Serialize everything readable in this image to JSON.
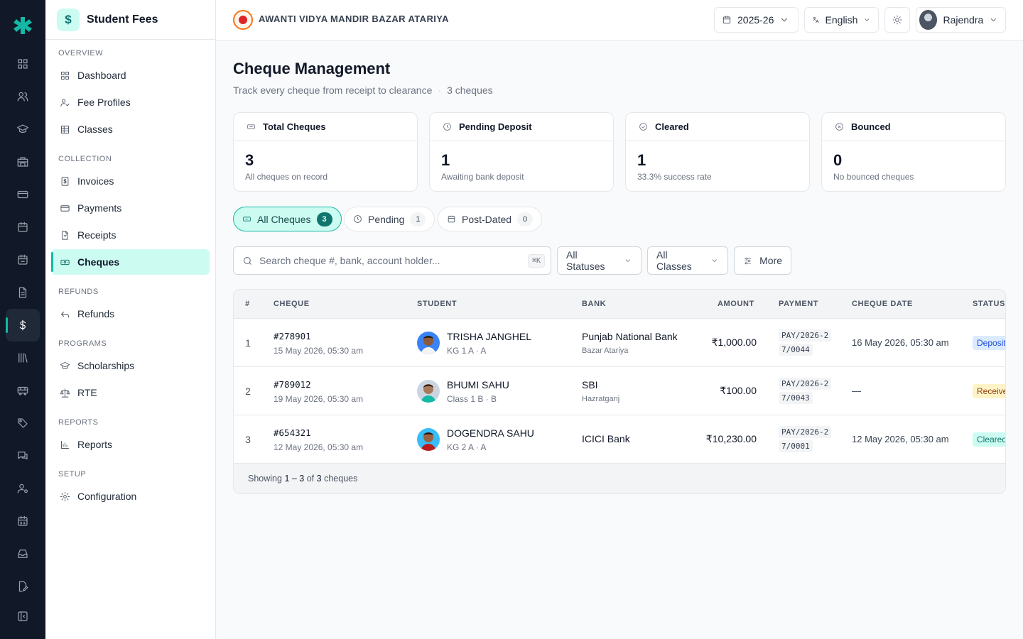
{
  "rail": {
    "icons": [
      "grid-icon",
      "users-icon",
      "graduation-cap-icon",
      "building-icon",
      "card-icon",
      "calendar-icon",
      "calendar-check-icon",
      "document-icon",
      "dollar-icon",
      "library-icon",
      "bus-icon",
      "tag-icon",
      "chat-icon",
      "user-cog-icon",
      "calendar-grid-icon",
      "inbox-icon",
      "file-edit-icon",
      "collapse-icon"
    ],
    "active": "dollar-icon"
  },
  "sidebar": {
    "badge": "$",
    "title": "Student Fees",
    "sections": {
      "overview": "OVERVIEW",
      "collection": "COLLECTION",
      "refunds": "REFUNDS",
      "programs": "PROGRAMS",
      "reports": "REPORTS",
      "setup": "SETUP"
    },
    "items": {
      "dashboard": "Dashboard",
      "fee_profiles": "Fee Profiles",
      "classes": "Classes",
      "invoices": "Invoices",
      "payments": "Payments",
      "receipts": "Receipts",
      "cheques": "Cheques",
      "refunds": "Refunds",
      "scholarships": "Scholarships",
      "rte": "RTE",
      "reports": "Reports",
      "configuration": "Configuration"
    },
    "active_item": "cheques"
  },
  "topbar": {
    "school_name": "AWANTI VIDYA MANDIR BAZAR ATARIYA",
    "session": "2025-26",
    "language": "English",
    "user": "Rajendra"
  },
  "page": {
    "title": "Cheque Management",
    "subtitle": "Track every cheque from receipt to clearance",
    "count_label": "3 cheques"
  },
  "stats": [
    {
      "label": "Total Cheques",
      "value": "3",
      "note": "All cheques on record",
      "icon": "cheque-icon"
    },
    {
      "label": "Pending Deposit",
      "value": "1",
      "note": "Awaiting bank deposit",
      "icon": "clock-icon"
    },
    {
      "label": "Cleared",
      "value": "1",
      "note": "33.3% success rate",
      "icon": "check-circle-icon"
    },
    {
      "label": "Bounced",
      "value": "0",
      "note": "No bounced cheques",
      "icon": "x-circle-icon"
    }
  ],
  "tabs": [
    {
      "label": "All Cheques",
      "count": "3",
      "active": true
    },
    {
      "label": "Pending",
      "count": "1",
      "active": false
    },
    {
      "label": "Post-Dated",
      "count": "0",
      "active": false
    }
  ],
  "filters": {
    "search_placeholder": "Search cheque #, bank, account holder...",
    "search_value": "",
    "shortcut": "⌘K",
    "status": "All Statuses",
    "class": "All Classes",
    "more": "More"
  },
  "table": {
    "columns": [
      "#",
      "CHEQUE",
      "STUDENT",
      "BANK",
      "AMOUNT",
      "PAYMENT",
      "CHEQUE DATE",
      "STATUS"
    ],
    "rows": [
      {
        "idx": "1",
        "cheque_no": "#278901",
        "cheque_received": "15 May 2026, 05:30 am",
        "student": "TRISHA JANGHEL",
        "class": "KG 1 A · A",
        "bank": "Punjab National Bank",
        "branch": "Bazar Atariya",
        "amount": "₹1,000.00",
        "payment": "PAY/2026-27/0044",
        "cheque_date": "16 May 2026, 05:30 am",
        "status": "Deposited",
        "status_bg": "#dbeafe",
        "status_fg": "#1d4ed8"
      },
      {
        "idx": "2",
        "cheque_no": "#789012",
        "cheque_received": "19 May 2026, 05:30 am",
        "student": "BHUMI SAHU",
        "class": "Class 1 B · B",
        "bank": "SBI",
        "branch": "Hazratganj",
        "amount": "₹100.00",
        "payment": "PAY/2026-27/0043",
        "cheque_date": "—",
        "status": "Received",
        "status_bg": "#fef3c7",
        "status_fg": "#92400e"
      },
      {
        "idx": "3",
        "cheque_no": "#654321",
        "cheque_received": "12 May 2026, 05:30 am",
        "student": "DOGENDRA SAHU",
        "class": "KG 2 A · A",
        "bank": "ICICI Bank",
        "branch": "",
        "amount": "₹10,230.00",
        "payment": "PAY/2026-27/0001",
        "cheque_date": "12 May 2026, 05:30 am",
        "status": "Cleared",
        "status_bg": "#ccfbf1",
        "status_fg": "#0f766e"
      }
    ],
    "footer_prefix": "Showing",
    "footer_range": "1 – 3",
    "footer_of": "of",
    "footer_total": "3",
    "footer_suffix": "cheques"
  }
}
